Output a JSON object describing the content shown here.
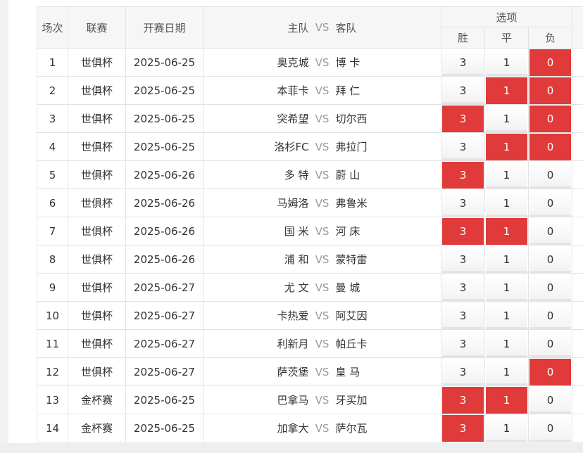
{
  "header": {
    "col_no": "场次",
    "col_league": "联赛",
    "col_date": "开赛日期",
    "col_home": "主队",
    "col_vs": "VS",
    "col_away": "客队",
    "col_options": "选项",
    "opt_win": "胜",
    "opt_draw": "平",
    "opt_lose": "负"
  },
  "options_values": {
    "win": "3",
    "draw": "1",
    "lose": "0"
  },
  "colors": {
    "selected": "#e03a3a",
    "header_bg": "#f6f6f6",
    "border": "#e3e3e3"
  },
  "rows": [
    {
      "no": "1",
      "league": "世俱杯",
      "date": "2025-06-25",
      "home": "奥克城",
      "vs": "VS",
      "away": "博 卡",
      "win": "3",
      "draw": "1",
      "lose": "0",
      "sel": [
        "lose"
      ]
    },
    {
      "no": "2",
      "league": "世俱杯",
      "date": "2025-06-25",
      "home": "本菲卡",
      "vs": "VS",
      "away": "拜 仁",
      "win": "3",
      "draw": "1",
      "lose": "0",
      "sel": [
        "draw",
        "lose"
      ]
    },
    {
      "no": "3",
      "league": "世俱杯",
      "date": "2025-06-25",
      "home": "突希望",
      "vs": "VS",
      "away": "切尔西",
      "win": "3",
      "draw": "1",
      "lose": "0",
      "sel": [
        "win",
        "lose"
      ]
    },
    {
      "no": "4",
      "league": "世俱杯",
      "date": "2025-06-25",
      "home": "洛杉FC",
      "vs": "VS",
      "away": "弗拉门",
      "win": "3",
      "draw": "1",
      "lose": "0",
      "sel": [
        "draw",
        "lose"
      ]
    },
    {
      "no": "5",
      "league": "世俱杯",
      "date": "2025-06-26",
      "home": "多 特",
      "vs": "VS",
      "away": "蔚 山",
      "win": "3",
      "draw": "1",
      "lose": "0",
      "sel": [
        "win"
      ]
    },
    {
      "no": "6",
      "league": "世俱杯",
      "date": "2025-06-26",
      "home": "马姆洛",
      "vs": "VS",
      "away": "弗鲁米",
      "win": "3",
      "draw": "1",
      "lose": "0",
      "sel": []
    },
    {
      "no": "7",
      "league": "世俱杯",
      "date": "2025-06-26",
      "home": "国 米",
      "vs": "VS",
      "away": "河 床",
      "win": "3",
      "draw": "1",
      "lose": "0",
      "sel": [
        "win",
        "draw"
      ]
    },
    {
      "no": "8",
      "league": "世俱杯",
      "date": "2025-06-26",
      "home": "浦 和",
      "vs": "VS",
      "away": "蒙特雷",
      "win": "3",
      "draw": "1",
      "lose": "0",
      "sel": []
    },
    {
      "no": "9",
      "league": "世俱杯",
      "date": "2025-06-27",
      "home": "尤 文",
      "vs": "VS",
      "away": "曼 城",
      "win": "3",
      "draw": "1",
      "lose": "0",
      "sel": []
    },
    {
      "no": "10",
      "league": "世俱杯",
      "date": "2025-06-27",
      "home": "卡热爱",
      "vs": "VS",
      "away": "阿艾因",
      "win": "3",
      "draw": "1",
      "lose": "0",
      "sel": []
    },
    {
      "no": "11",
      "league": "世俱杯",
      "date": "2025-06-27",
      "home": "利新月",
      "vs": "VS",
      "away": "帕丘卡",
      "win": "3",
      "draw": "1",
      "lose": "0",
      "sel": []
    },
    {
      "no": "12",
      "league": "世俱杯",
      "date": "2025-06-27",
      "home": "萨茨堡",
      "vs": "VS",
      "away": "皇 马",
      "win": "3",
      "draw": "1",
      "lose": "0",
      "sel": [
        "lose"
      ]
    },
    {
      "no": "13",
      "league": "金杯赛",
      "date": "2025-06-25",
      "home": "巴拿马",
      "vs": "VS",
      "away": "牙买加",
      "win": "3",
      "draw": "1",
      "lose": "0",
      "sel": [
        "win",
        "draw"
      ]
    },
    {
      "no": "14",
      "league": "金杯赛",
      "date": "2025-06-25",
      "home": "加拿大",
      "vs": "VS",
      "away": "萨尔瓦",
      "win": "3",
      "draw": "1",
      "lose": "0",
      "sel": [
        "win"
      ]
    }
  ]
}
